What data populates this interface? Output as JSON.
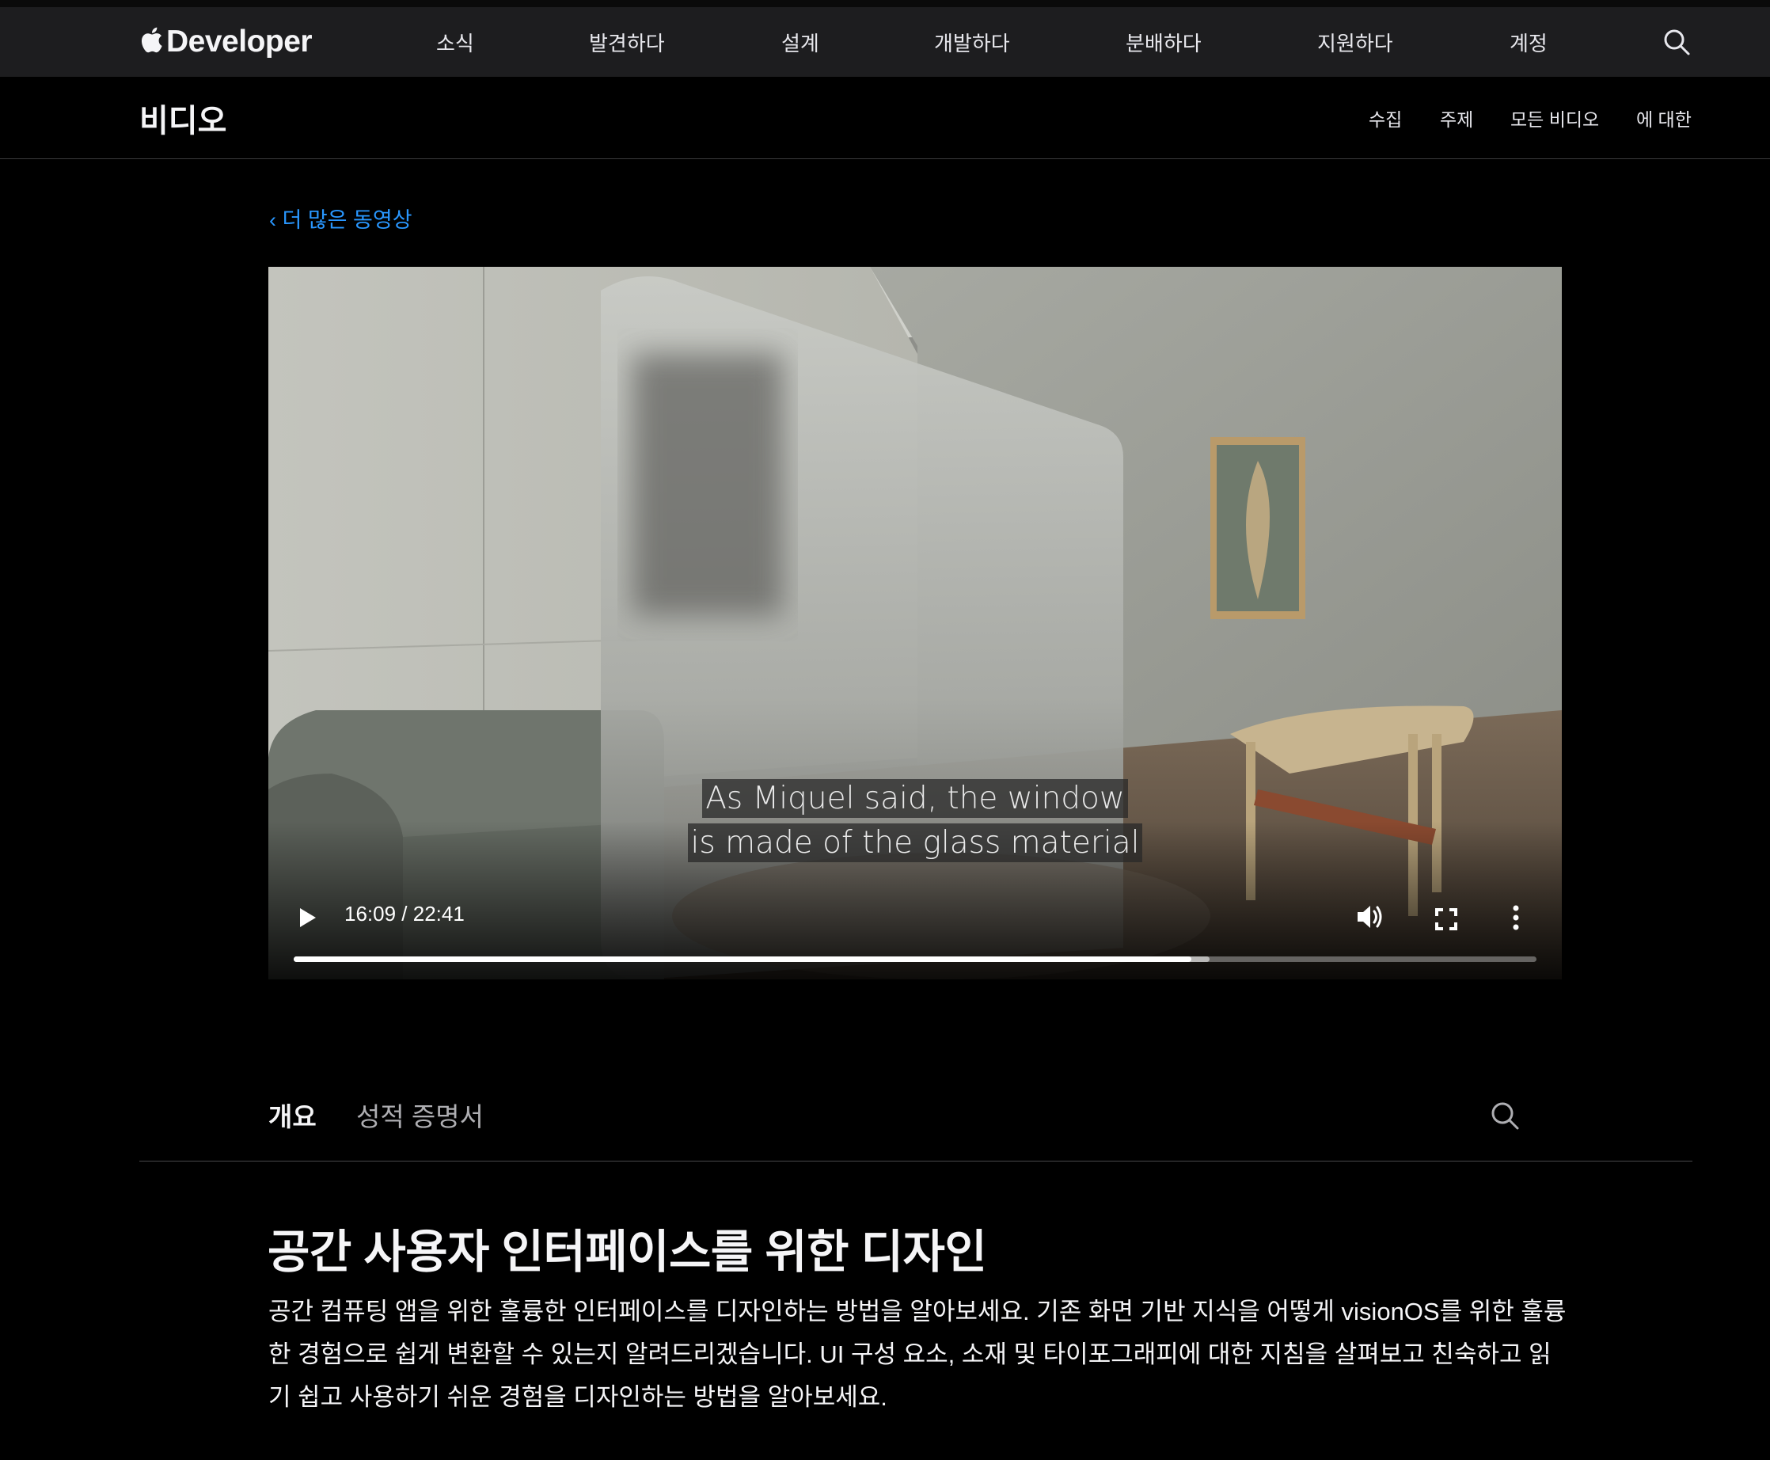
{
  "globalnav": {
    "brand": "Developer",
    "items": [
      {
        "label": "소식"
      },
      {
        "label": "발견하다"
      },
      {
        "label": "설계"
      },
      {
        "label": "개발하다"
      },
      {
        "label": "분배하다"
      },
      {
        "label": "지원하다"
      },
      {
        "label": "계정"
      }
    ],
    "search_icon": "search-icon"
  },
  "localnav": {
    "title": "비디오",
    "links": [
      {
        "label": "수집"
      },
      {
        "label": "주제"
      },
      {
        "label": "모든 비디오"
      },
      {
        "label": "에 대한"
      }
    ]
  },
  "back_link": "‹ 더 많은 동영상",
  "video": {
    "caption_line1": "As Miquel said, the window",
    "caption_line2": "is made of the glass material",
    "time": "16:09 / 22:41",
    "progress_fraction": 0.722,
    "controls": [
      "play-icon",
      "volume-icon",
      "fullscreen-icon",
      "more-icon"
    ]
  },
  "tabs": {
    "items": [
      {
        "label": "개요",
        "active": true
      },
      {
        "label": "성적 증명서",
        "active": false
      }
    ],
    "search_icon": "search-icon"
  },
  "content": {
    "title": "공간 사용자 인터페이스를 위한 디자인",
    "description": "공간 컴퓨팅 앱을 위한 훌륭한 인터페이스를 디자인하는 방법을 알아보세요. 기존 화면 기반 지식을 어떻게 visionOS를 위한 훌륭한 경험으로 쉽게 변환할 수 있는지 알려드리겠습니다. UI 구성 요소, 소재 및 타이포그래피에 대한 지침을 살펴보고 친숙하고 읽기 쉽고 사용하기 쉬운 경험을 디자인하는 방법을 알아보세요."
  },
  "colors": {
    "accent_link": "#2997ff",
    "nav_bg": "#1d1d1f",
    "page_bg": "#000000"
  }
}
